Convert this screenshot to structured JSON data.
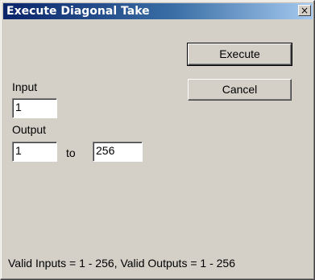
{
  "window": {
    "title": "Execute Diagonal Take",
    "close_label": "×"
  },
  "buttons": {
    "execute_label": "Execute",
    "cancel_label": "Cancel"
  },
  "input": {
    "label": "Input",
    "value": "1"
  },
  "output": {
    "label": "Output",
    "from_value": "1",
    "to_label": "to",
    "to_value": "256"
  },
  "status": {
    "text": "Valid Inputs = 1 - 256, Valid Outputs = 1 - 256"
  }
}
